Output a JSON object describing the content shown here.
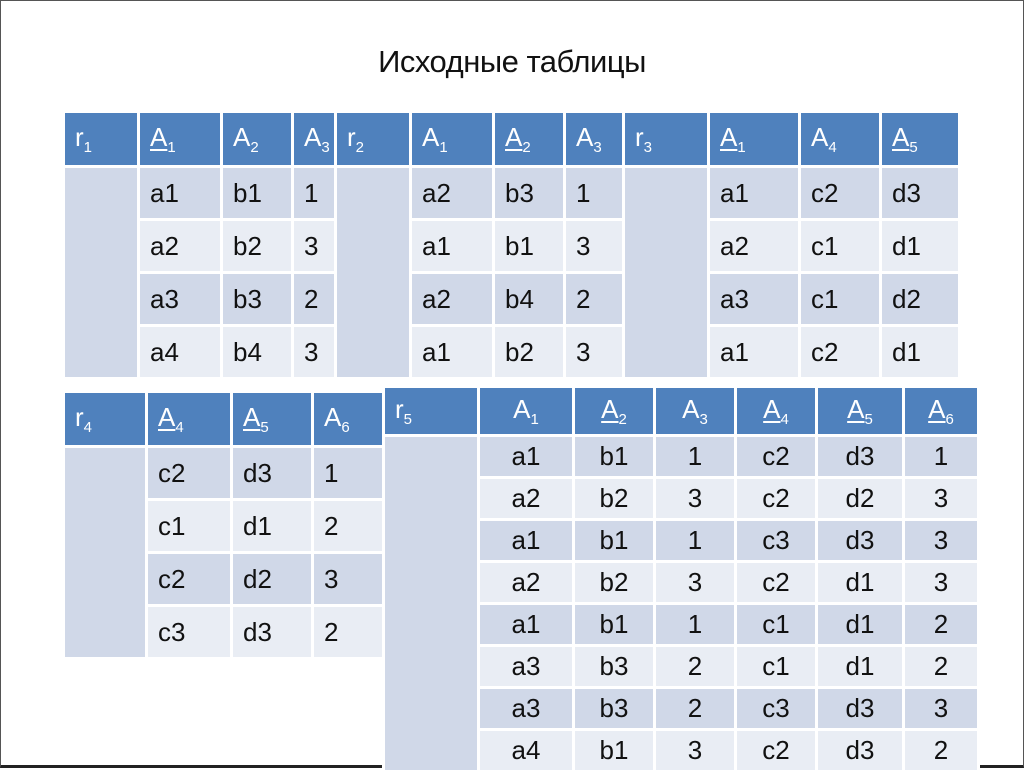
{
  "title": "Исходные таблицы",
  "tables": [
    {
      "name": "r",
      "name_sub": "1",
      "columns": [
        {
          "label": "A",
          "sub": "1",
          "key": true
        },
        {
          "label": "A",
          "sub": "2",
          "key": false
        },
        {
          "label": "A",
          "sub": "3",
          "key": false
        }
      ],
      "rows": [
        [
          "a1",
          "b1",
          "1"
        ],
        [
          "a2",
          "b2",
          "3"
        ],
        [
          "a3",
          "b3",
          "2"
        ],
        [
          "a4",
          "b4",
          "3"
        ]
      ]
    },
    {
      "name": "r",
      "name_sub": "2",
      "columns": [
        {
          "label": "A",
          "sub": "1",
          "key": false
        },
        {
          "label": "A",
          "sub": "2",
          "key": true
        },
        {
          "label": "A",
          "sub": "3",
          "key": false
        }
      ],
      "rows": [
        [
          "a2",
          "b3",
          "1"
        ],
        [
          "a1",
          "b1",
          "3"
        ],
        [
          "a2",
          "b4",
          "2"
        ],
        [
          "a1",
          "b2",
          "3"
        ]
      ]
    },
    {
      "name": "r",
      "name_sub": "3",
      "columns": [
        {
          "label": "A",
          "sub": "1",
          "key": true
        },
        {
          "label": "A",
          "sub": "4",
          "key": false
        },
        {
          "label": "A",
          "sub": "5",
          "key": true
        }
      ],
      "rows": [
        [
          "a1",
          "c2",
          "d3"
        ],
        [
          "a2",
          "c1",
          "d1"
        ],
        [
          "a3",
          "c1",
          "d2"
        ],
        [
          "a1",
          "c2",
          "d1"
        ]
      ]
    },
    {
      "name": "r",
      "name_sub": "4",
      "columns": [
        {
          "label": "A",
          "sub": "4",
          "key": true
        },
        {
          "label": "A",
          "sub": "5",
          "key": true
        },
        {
          "label": "A",
          "sub": "6",
          "key": false
        }
      ],
      "rows": [
        [
          "c2",
          "d3",
          "1"
        ],
        [
          "c1",
          "d1",
          "2"
        ],
        [
          "c2",
          "d2",
          "3"
        ],
        [
          "c3",
          "d3",
          "2"
        ]
      ]
    },
    {
      "name": "r",
      "name_sub": "5",
      "columns": [
        {
          "label": "A",
          "sub": "1",
          "key": false
        },
        {
          "label": "A",
          "sub": "2",
          "key": true
        },
        {
          "label": "A",
          "sub": "3",
          "key": false
        },
        {
          "label": "A",
          "sub": "4",
          "key": true
        },
        {
          "label": "A",
          "sub": "5",
          "key": true
        },
        {
          "label": "A",
          "sub": "6",
          "key": true
        }
      ],
      "rows": [
        [
          "a1",
          "b1",
          "1",
          "c2",
          "d3",
          "1"
        ],
        [
          "a2",
          "b2",
          "3",
          "c2",
          "d2",
          "3"
        ],
        [
          "a1",
          "b1",
          "1",
          "c3",
          "d3",
          "3"
        ],
        [
          "a2",
          "b2",
          "3",
          "c2",
          "d1",
          "3"
        ],
        [
          "a1",
          "b1",
          "1",
          "c1",
          "d1",
          "2"
        ],
        [
          "a3",
          "b3",
          "2",
          "c1",
          "d1",
          "2"
        ],
        [
          "a3",
          "b3",
          "2",
          "c3",
          "d3",
          "3"
        ],
        [
          "a4",
          "b1",
          "3",
          "c2",
          "d3",
          "2"
        ]
      ]
    }
  ],
  "colors": {
    "header": "#4f81bd",
    "row_dark": "#d0d8e8",
    "row_light": "#e9edf4"
  }
}
